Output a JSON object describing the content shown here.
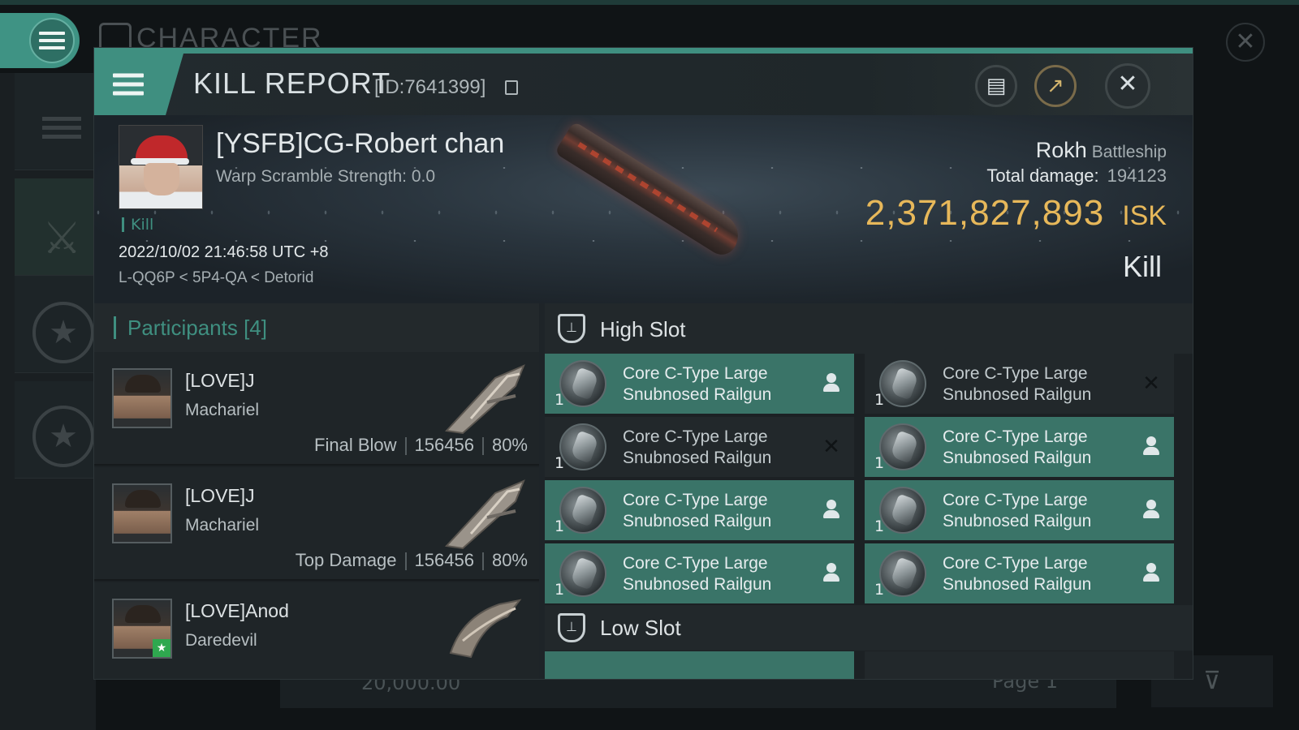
{
  "background": {
    "title": "CHARACTER",
    "bottom_value": "20,000.00",
    "bottom_page": "Page 1"
  },
  "header": {
    "title": "KILL REPORT",
    "id_text": "[ID:7641399]"
  },
  "victim": {
    "name": "[YSFB]CG-Robert chan",
    "warp_scramble": "Warp Scramble Strength: 0.0",
    "kill_tag": "Kill",
    "datetime": "2022/10/02 21:46:58 UTC +8",
    "location": "L-QQ6P < 5P4-QA < Detorid",
    "ship_name": "Rokh",
    "ship_class": "Battleship",
    "total_damage_label": "Total damage:",
    "total_damage": "194123",
    "isk_value": "2,371,827,893",
    "isk_unit": "ISK",
    "result": "Kill"
  },
  "participants": {
    "header": "Participants [4]",
    "rows": [
      {
        "name": "[LOVE]J",
        "ship": "Machariel",
        "role": "Final Blow",
        "damage": "156456",
        "percent": "80%"
      },
      {
        "name": "[LOVE]J",
        "ship": "Machariel",
        "role": "Top Damage",
        "damage": "156456",
        "percent": "80%"
      },
      {
        "name": "[LOVE]Anod",
        "ship": "Daredevil",
        "role": "",
        "damage": "",
        "percent": ""
      }
    ]
  },
  "slots": {
    "high_slot_label": "High Slot",
    "low_slot_label": "Low Slot",
    "high_modules": [
      {
        "name_line1": "Core C-Type Large",
        "name_line2": "Snubnosed Railgun",
        "qty": "1",
        "status": "dropped"
      },
      {
        "name_line1": "Core C-Type Large",
        "name_line2": "Snubnosed Railgun",
        "qty": "1",
        "status": "destroyed"
      },
      {
        "name_line1": "Core C-Type Large",
        "name_line2": "Snubnosed Railgun",
        "qty": "1",
        "status": "destroyed"
      },
      {
        "name_line1": "Core C-Type Large",
        "name_line2": "Snubnosed Railgun",
        "qty": "1",
        "status": "dropped"
      },
      {
        "name_line1": "Core C-Type Large",
        "name_line2": "Snubnosed Railgun",
        "qty": "1",
        "status": "dropped"
      },
      {
        "name_line1": "Core C-Type Large",
        "name_line2": "Snubnosed Railgun",
        "qty": "1",
        "status": "dropped"
      },
      {
        "name_line1": "Core C-Type Large",
        "name_line2": "Snubnosed Railgun",
        "qty": "1",
        "status": "dropped"
      },
      {
        "name_line1": "Core C-Type Large",
        "name_line2": "Snubnosed Railgun",
        "qty": "1",
        "status": "dropped"
      }
    ]
  },
  "colors": {
    "accent": "#3f8f80",
    "isk": "#e7b85a",
    "module_dropped": "#3a7468",
    "module_destroyed": "#22282b"
  }
}
